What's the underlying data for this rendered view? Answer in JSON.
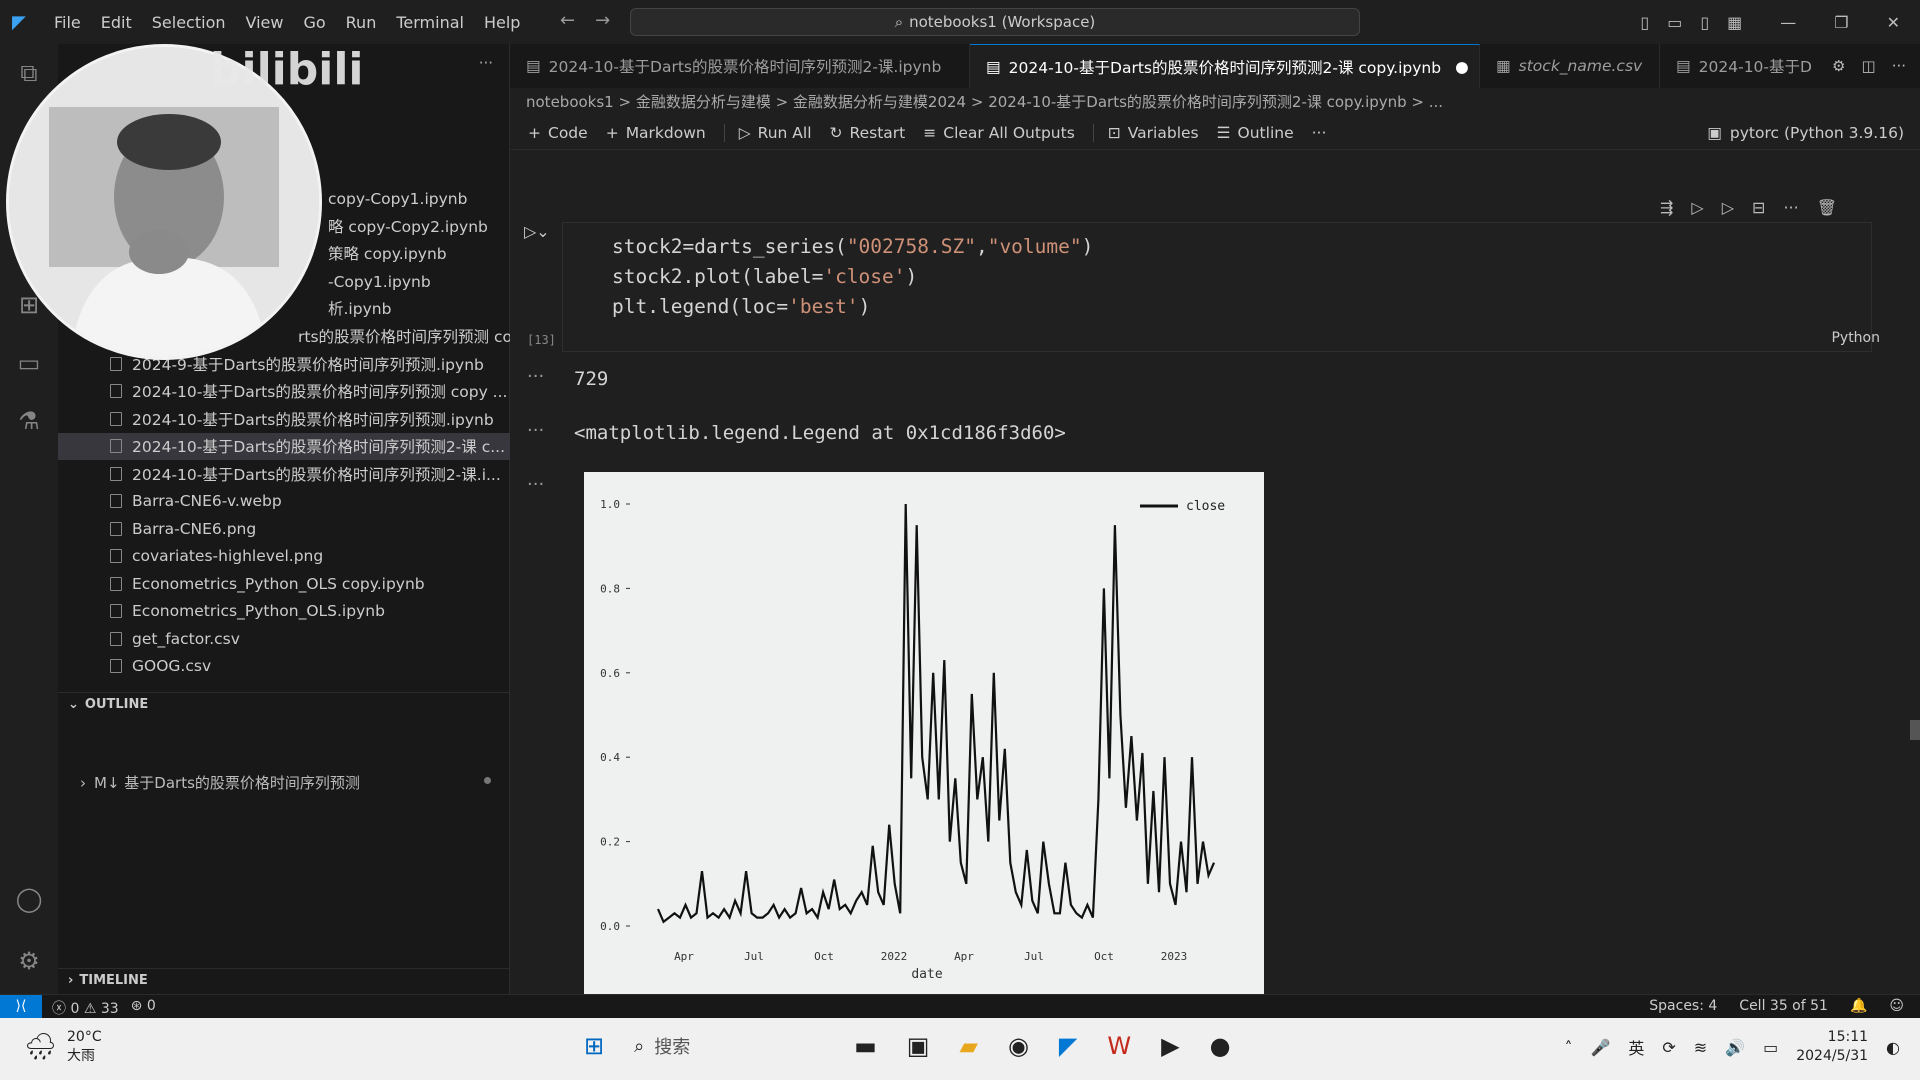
{
  "menu": [
    "File",
    "Edit",
    "Selection",
    "View",
    "Go",
    "Run",
    "Terminal",
    "Help"
  ],
  "command_center": "notebooks1 (Workspace)",
  "tabs": [
    {
      "label": "2024-10-基于Darts的股票价格时间序列预测2-课.ipynb",
      "active": false
    },
    {
      "label": "2024-10-基于Darts的股票价格时间序列预测2-课 copy.ipynb",
      "active": true,
      "modified": true
    },
    {
      "label": "stock_name.csv",
      "active": false
    },
    {
      "label": "2024-10-基于D",
      "active": false
    }
  ],
  "breadcrumb": "notebooks1 > 金融数据分析与建模 > 金融数据分析与建模2024 > 2024-10-基于Darts的股票价格时间序列预测2-课 copy.ipynb > ...",
  "toolbar": {
    "code": "Code",
    "markdown": "Markdown",
    "run_all": "Run All",
    "restart": "Restart",
    "clear": "Clear All Outputs",
    "variables": "Variables",
    "outline": "Outline",
    "more": "···"
  },
  "kernel": "pytorc (Python 3.9.16)",
  "sidebar": {
    "partial_files": [
      "copy-Copy1.ipynb",
      "略 copy-Copy2.ipynb",
      "策略 copy.ipynb",
      "-Copy1.ipynb",
      "析.ipynb",
      "rts的股票价格时间序列预测 copy.ip..."
    ],
    "files": [
      "2024-9-基于Darts的股票价格时间序列预测.ipynb",
      "2024-10-基于Darts的股票价格时间序列预测 copy ...",
      "2024-10-基于Darts的股票价格时间序列预测.ipynb",
      "2024-10-基于Darts的股票价格时间序列预测2-课 c...",
      "2024-10-基于Darts的股票价格时间序列预测2-课.i...",
      "Barra-CNE6-v.webp",
      "Barra-CNE6.png",
      "covariates-highlevel.png",
      "Econometrics_Python_OLS copy.ipynb",
      "Econometrics_Python_OLS.ipynb",
      "get_factor.csv",
      "GOOG.csv"
    ],
    "selected_index": 3,
    "outline_header": "OUTLINE",
    "outline_item": "M↓ 基于Darts的股票价格时间序列预测",
    "timeline_header": "TIMELINE"
  },
  "cell": {
    "exec_count": "[13]",
    "language": "Python",
    "code_lines": [
      [
        "stock2=darts_series(",
        "\"002758.SZ\"",
        ",",
        "\"volume\"",
        ")"
      ],
      [
        "stock2.plot(label=",
        "'close'",
        ")"
      ],
      [
        "plt.legend(loc=",
        "'best'",
        ")"
      ]
    ],
    "output1": "729",
    "output2": "<matplotlib.legend.Legend at 0x1cd186f3d60>"
  },
  "chart_data": {
    "type": "line",
    "xlabel": "date",
    "ylabel": "",
    "ylim": [
      0,
      1.0
    ],
    "yticks": [
      "0.0",
      "0.2",
      "0.4",
      "0.6",
      "0.8",
      "1.0"
    ],
    "xticks": [
      "Apr",
      "Jul",
      "Oct",
      "2022",
      "Apr",
      "Jul",
      "Oct",
      "2023"
    ],
    "legend": "close",
    "legend_position": "top-right",
    "series": [
      {
        "name": "close",
        "values": [
          0.04,
          0.01,
          0.02,
          0.03,
          0.02,
          0.05,
          0.02,
          0.03,
          0.13,
          0.02,
          0.03,
          0.02,
          0.04,
          0.02,
          0.06,
          0.03,
          0.13,
          0.03,
          0.02,
          0.02,
          0.03,
          0.05,
          0.02,
          0.04,
          0.02,
          0.03,
          0.09,
          0.03,
          0.04,
          0.02,
          0.08,
          0.04,
          0.11,
          0.04,
          0.05,
          0.03,
          0.06,
          0.08,
          0.05,
          0.19,
          0.08,
          0.05,
          0.24,
          0.1,
          0.03,
          1.0,
          0.35,
          0.95,
          0.4,
          0.3,
          0.6,
          0.3,
          0.63,
          0.2,
          0.35,
          0.15,
          0.1,
          0.55,
          0.3,
          0.4,
          0.2,
          0.6,
          0.25,
          0.42,
          0.15,
          0.08,
          0.05,
          0.18,
          0.06,
          0.03,
          0.2,
          0.1,
          0.03,
          0.03,
          0.15,
          0.05,
          0.03,
          0.02,
          0.05,
          0.02,
          0.3,
          0.8,
          0.35,
          0.95,
          0.5,
          0.28,
          0.45,
          0.25,
          0.41,
          0.1,
          0.32,
          0.08,
          0.4,
          0.1,
          0.05,
          0.2,
          0.08,
          0.4,
          0.1,
          0.2,
          0.12,
          0.15
        ]
      }
    ]
  },
  "status": {
    "errors": "0",
    "warnings": "33",
    "ports": "0",
    "spaces": "Spaces: 4",
    "cell": "Cell 35 of 51"
  },
  "taskbar": {
    "weather_temp": "20°C",
    "weather_desc": "大雨",
    "search": "搜索",
    "time": "15:11",
    "date": "2024/5/31"
  },
  "watermark": "bilibili"
}
